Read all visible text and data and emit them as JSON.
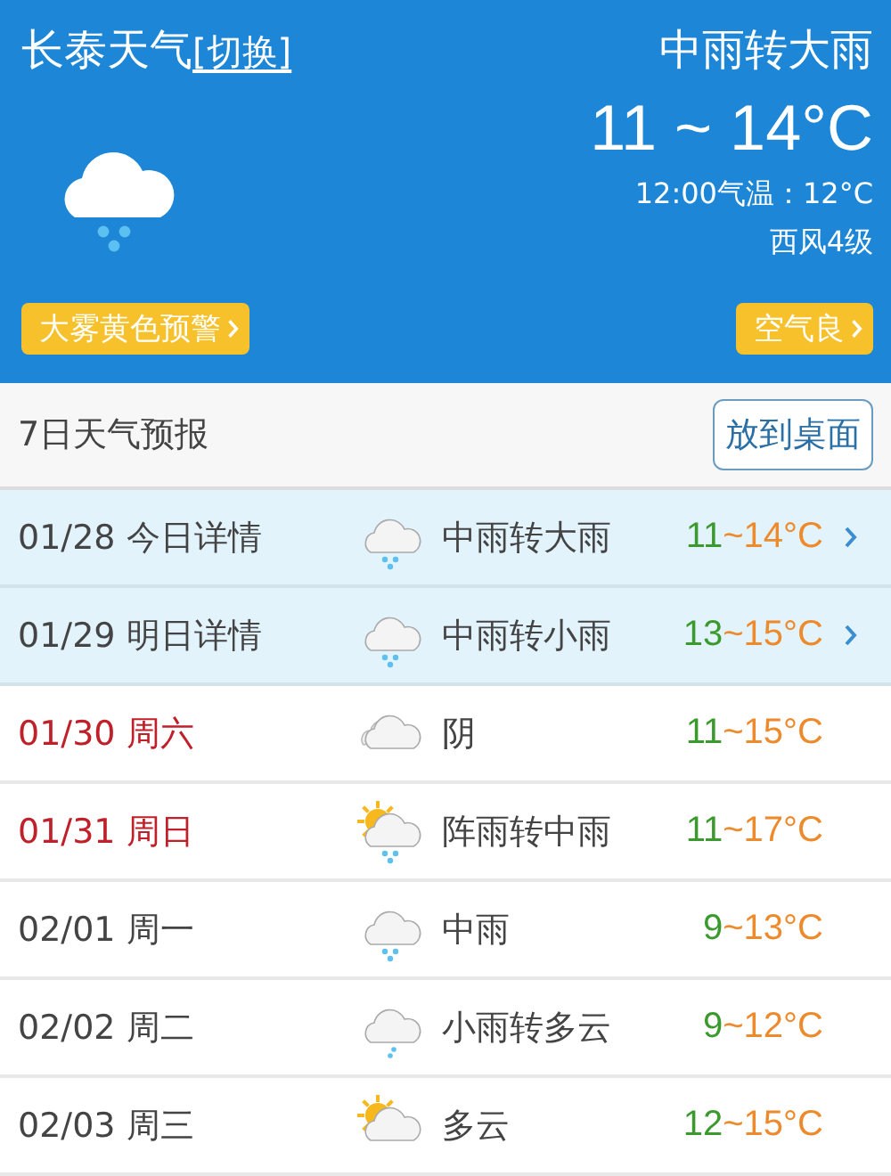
{
  "header": {
    "city": "长泰天气",
    "switch_link": "[切换]",
    "condition": "中雨转大雨",
    "temperature": "11 ~ 14°C",
    "noon_temp": "12:00气温：12°C",
    "wind": "西风4级",
    "kind": "cloud-rain",
    "warning": "大雾黄色预警",
    "air_quality": "空气良"
  },
  "forecast": {
    "title": "7日天气预报",
    "button": "放到桌面",
    "days": [
      {
        "date": "01/28",
        "day": "今日详情",
        "weekend": false,
        "highlighted": true,
        "kind": "cloud-rain",
        "condition": "中雨转大雨",
        "low": "11",
        "high": "~14°C"
      },
      {
        "date": "01/29",
        "day": "明日详情",
        "weekend": false,
        "highlighted": true,
        "kind": "cloud-rain",
        "condition": "中雨转小雨",
        "low": "13",
        "high": "~15°C"
      },
      {
        "date": "01/30",
        "day": "周六",
        "weekend": true,
        "highlighted": false,
        "kind": "clouds",
        "condition": "阴",
        "low": "11",
        "high": "~15°C"
      },
      {
        "date": "01/31",
        "day": "周日",
        "weekend": true,
        "highlighted": false,
        "kind": "sun-cloud-rain",
        "condition": "阵雨转中雨",
        "low": "11",
        "high": "~17°C"
      },
      {
        "date": "02/01",
        "day": "周一",
        "weekend": false,
        "highlighted": false,
        "kind": "cloud-rain",
        "condition": "中雨",
        "low": "9",
        "high": "~13°C"
      },
      {
        "date": "02/02",
        "day": "周二",
        "weekend": false,
        "highlighted": false,
        "kind": "cloud-drizzle",
        "condition": "小雨转多云",
        "low": "9",
        "high": "~12°C"
      },
      {
        "date": "02/03",
        "day": "周三",
        "weekend": false,
        "highlighted": false,
        "kind": "sun-cloud",
        "condition": "多云",
        "low": "12",
        "high": "~15°C"
      }
    ]
  }
}
